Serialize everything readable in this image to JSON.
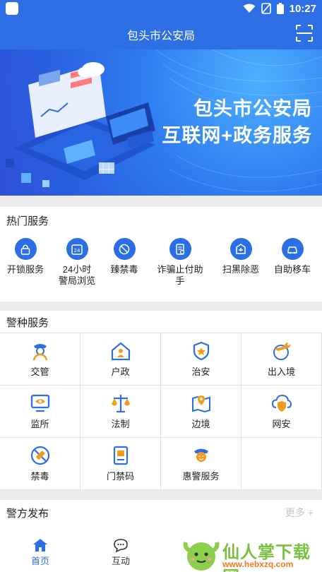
{
  "status_bar": {
    "time": "10:27"
  },
  "app_bar": {
    "title": "包头市公安局",
    "scan_icon": "scan-icon"
  },
  "banner": {
    "line1": "包头市公安局",
    "line2": "互联网+政务服务"
  },
  "hot_services": {
    "title": "热门服务",
    "items": [
      {
        "label": "开锁服务",
        "icon": "lock-icon"
      },
      {
        "label": "24小时\n警局浏览",
        "icon": "clock-24-icon"
      },
      {
        "label": "臻禁毒",
        "icon": "no-drugs-icon"
      },
      {
        "label": "诈骗止付助手",
        "icon": "fraud-stop-icon"
      },
      {
        "label": "扫黑除恶",
        "icon": "anti-crime-icon"
      },
      {
        "label": "自助移车",
        "icon": "car-move-icon"
      }
    ]
  },
  "police_services": {
    "title": "警种服务",
    "items": [
      {
        "label": "交管",
        "icon": "traffic-police-icon"
      },
      {
        "label": "户政",
        "icon": "household-icon"
      },
      {
        "label": "治安",
        "icon": "badge-shield-icon"
      },
      {
        "label": "出入境",
        "icon": "airplane-icon"
      },
      {
        "label": "监所",
        "icon": "monitor-eye-icon"
      },
      {
        "label": "法制",
        "icon": "scales-icon"
      },
      {
        "label": "边境",
        "icon": "map-pin-icon"
      },
      {
        "label": "网安",
        "icon": "cloud-shield-icon"
      },
      {
        "label": "禁毒",
        "icon": "no-syringe-icon"
      },
      {
        "label": "门禁码",
        "icon": "door-card-icon"
      },
      {
        "label": "惠警服务",
        "icon": "officer-icon"
      }
    ]
  },
  "police_release": {
    "title": "警方发布",
    "more": "更多 +"
  },
  "tab_bar": {
    "tabs": [
      {
        "label": "首页",
        "icon": "home-icon",
        "active": true
      },
      {
        "label": "互动",
        "icon": "chat-icon",
        "active": false
      }
    ]
  },
  "watermark": {
    "text": "仙人掌下载网",
    "url": "www.hebxzq.com"
  },
  "colors": {
    "primary": "#2f6fe5",
    "accent_orange": "#f39a1f",
    "divider": "#e2e2e2"
  }
}
